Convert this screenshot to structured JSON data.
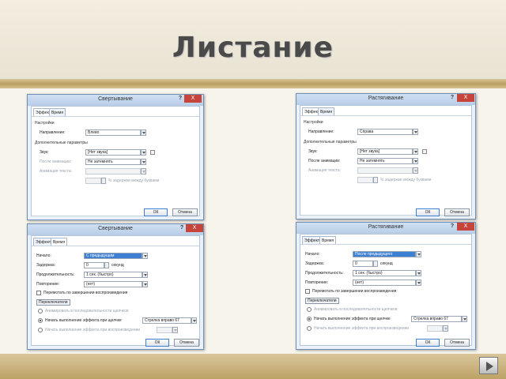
{
  "slide": {
    "title": "Листание"
  },
  "colors": {
    "accent": "#3c7fd3",
    "band": "#c8b07a",
    "close": "#c7443a"
  },
  "dialogs": {
    "d1": {
      "title": "Свертывание",
      "help": "?",
      "close": "X",
      "tabs": [
        "Эффект",
        "Время"
      ],
      "settings_header": "Настройки",
      "direction_label": "Направление:",
      "direction_value": "Влево",
      "extra_header": "Дополнительные параметры",
      "sound_label": "Звук:",
      "sound_value": "[Нет звука]",
      "after_anim_label": "После анимации:",
      "after_anim_value": "Не затемнять",
      "anim_text_label": "Анимация текста:",
      "anim_text_value": "",
      "delay_text": "% задержки между буквами",
      "ok": "ОК",
      "cancel": "Отмена"
    },
    "d2": {
      "title": "Растягивание",
      "help": "?",
      "close": "X",
      "tabs": [
        "Эффект",
        "Время"
      ],
      "settings_header": "Настройки",
      "direction_label": "Направление:",
      "direction_value": "Справа",
      "extra_header": "Дополнительные параметры",
      "sound_label": "Звук:",
      "sound_value": "[Нет звука]",
      "after_anim_label": "После анимации:",
      "after_anim_value": "Не затемнять",
      "anim_text_label": "Анимация текста:",
      "anim_text_value": "",
      "delay_text": "% задержки между буквами",
      "ok": "ОК",
      "cancel": "Отмена"
    },
    "d3": {
      "title": "Свертывание",
      "help": "?",
      "close": "X",
      "tabs": [
        "Эффект",
        "Время"
      ],
      "start_label": "Начало:",
      "start_value": "С предыдущим",
      "delay_label": "Задержка:",
      "delay_value": "0",
      "delay_unit": "секунд",
      "duration_label": "Продолжительность:",
      "duration_value": "1 сек. (быстро)",
      "repeat_label": "Повторение:",
      "repeat_value": "(нет)",
      "rewind_label": "Перемотать по завершении воспроизведения",
      "triggers_label": "Переключатели",
      "anim_sequence": "Анимировать в последовательности щелчков",
      "start_effect_on_click": "Начать выполнение эффекта при щелчке",
      "start_effect_value": "Стрелка вправо 67",
      "start_on_play": "Начать выполнение эффекта при воспроизведении",
      "ok": "ОК",
      "cancel": "Отмена"
    },
    "d4": {
      "title": "Растягивание",
      "help": "?",
      "close": "X",
      "tabs": [
        "Эффект",
        "Время"
      ],
      "start_label": "Начало:",
      "start_value": "После предыдущего",
      "delay_label": "Задержка:",
      "delay_value": "0",
      "delay_unit": "секунд",
      "duration_label": "Продолжительность:",
      "duration_value": "1 сек. (быстро)",
      "repeat_label": "Повторение:",
      "repeat_value": "(нет)",
      "rewind_label": "Перемотать по завершении воспроизведения",
      "triggers_label": "Переключатели",
      "anim_sequence": "Анимировать в последовательности щелчков",
      "start_effect_on_click": "Начать выполнение эффекта при щелчке",
      "start_effect_value": "Стрелка вправо 67",
      "start_on_play": "Начать выполнение эффекта при воспроизведении",
      "ok": "ОК",
      "cancel": "Отмена"
    }
  }
}
